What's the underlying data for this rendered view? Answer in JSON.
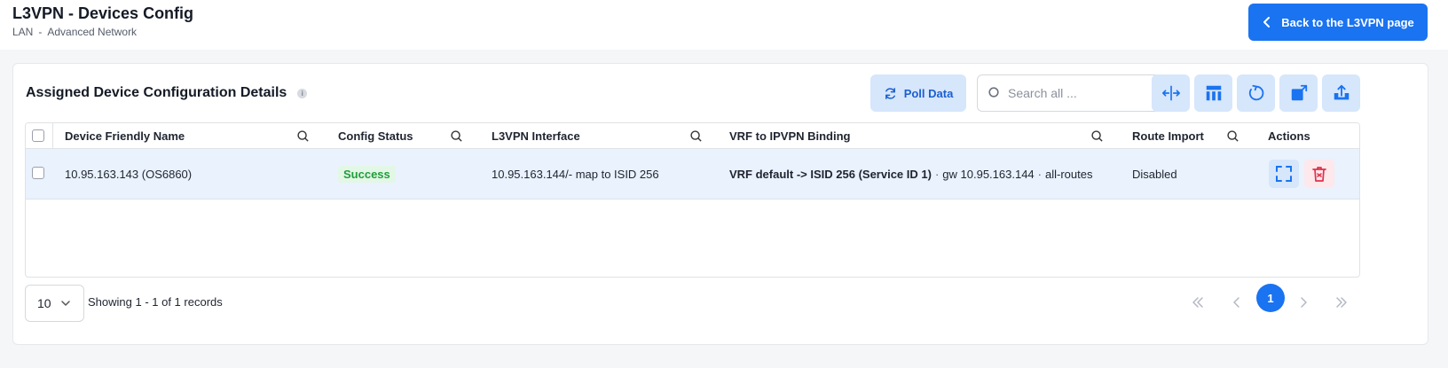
{
  "header": {
    "title": "L3VPN - Devices Config",
    "breadcrumb": [
      "LAN",
      "-",
      "Advanced Network"
    ],
    "back_button": "Back to the L3VPN page"
  },
  "card": {
    "title": "Assigned Device Configuration Details",
    "info_icon": "i",
    "poll_button": "Poll Data",
    "search_placeholder": "Search all ...",
    "tool_icons": [
      "column-resize-icon",
      "table-layout-icon",
      "refresh-icon",
      "open-external-icon",
      "export-icon"
    ]
  },
  "table": {
    "columns": [
      "Device Friendly Name",
      "Config Status",
      "L3VPN Interface",
      "VRF to IPVPN Binding",
      "Route Import",
      "Actions"
    ],
    "rows": [
      {
        "device": "10.95.163.143 (OS6860)",
        "status": "Success",
        "interface": "10.95.163.144/- map to ISID 256",
        "vrf_binding": "VRF default -> ISID 256 (Service ID 1)",
        "vrf_sep1": "·",
        "vrf_gw": "gw 10.95.163.144",
        "vrf_sep2": "·",
        "vrf_routes": "all-routes",
        "route_import": "Disabled"
      }
    ]
  },
  "pagination": {
    "page_size": "10",
    "records_text": "Showing 1 - 1 of 1 records",
    "current_page": "1"
  },
  "colors": {
    "primary": "#1a73f0",
    "tool_bg": "#d6e6fb",
    "success": "#1f9d3a",
    "danger": "#e0304a",
    "row_highlight": "#e9f2fd"
  }
}
